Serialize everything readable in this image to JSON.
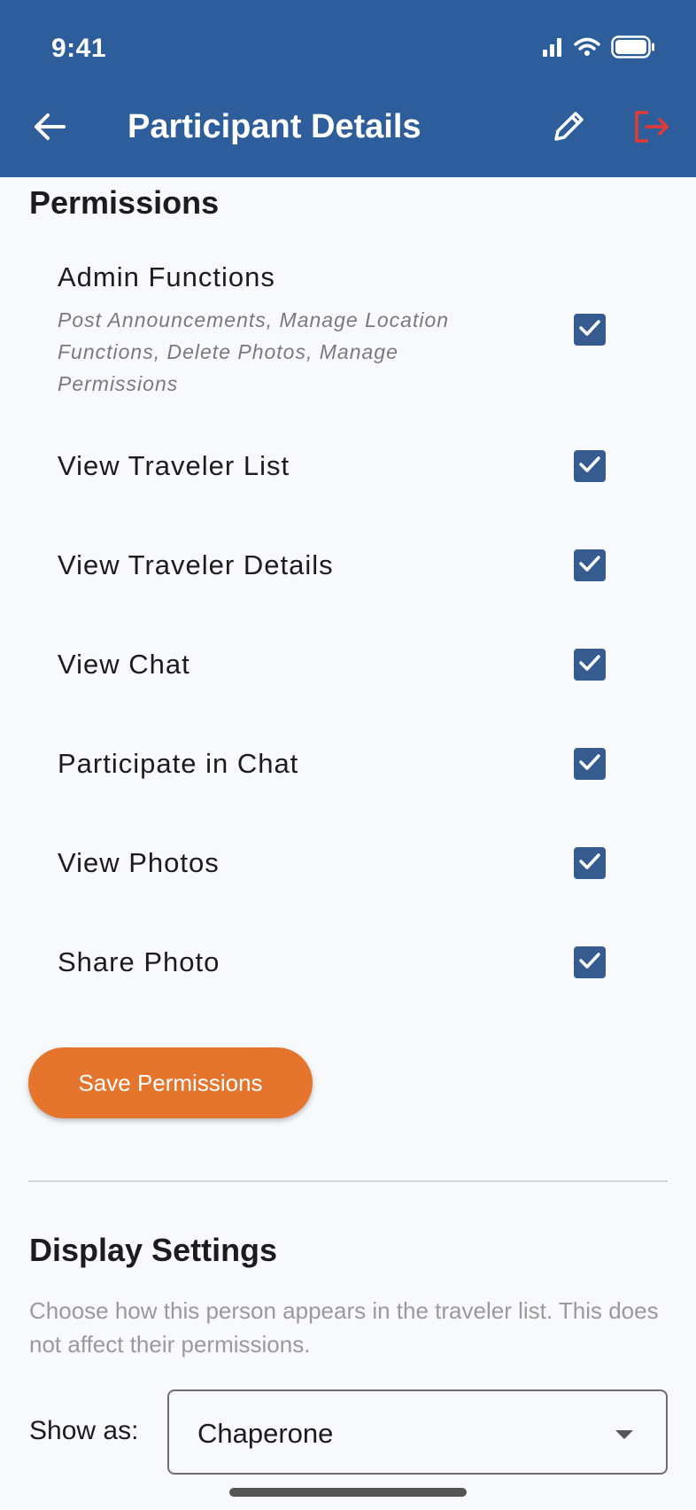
{
  "status_bar": {
    "time": "9:41"
  },
  "app_bar": {
    "title": "Participant Details"
  },
  "permissions": {
    "title": "Permissions",
    "items": [
      {
        "label": "Admin Functions",
        "description": "Post Announcements, Manage Location Functions, Delete Photos, Manage Permissions",
        "checked": true
      },
      {
        "label": "View Traveler List",
        "checked": true
      },
      {
        "label": "View Traveler Details",
        "checked": true
      },
      {
        "label": "View Chat",
        "checked": true
      },
      {
        "label": "Participate in Chat",
        "checked": true
      },
      {
        "label": "View Photos",
        "checked": true
      },
      {
        "label": "Share Photo",
        "checked": true
      }
    ],
    "save_label": "Save Permissions"
  },
  "display_settings": {
    "title": "Display Settings",
    "description": "Choose how this person appears in the traveler list. This does not affect their permissions.",
    "show_as_label": "Show as:",
    "show_as_value": "Chaperone"
  },
  "colors": {
    "app_bar": "#2d5d9a",
    "checkbox": "#355b8f",
    "primary_button": "#e5752d",
    "logout_icon": "#e53935"
  }
}
